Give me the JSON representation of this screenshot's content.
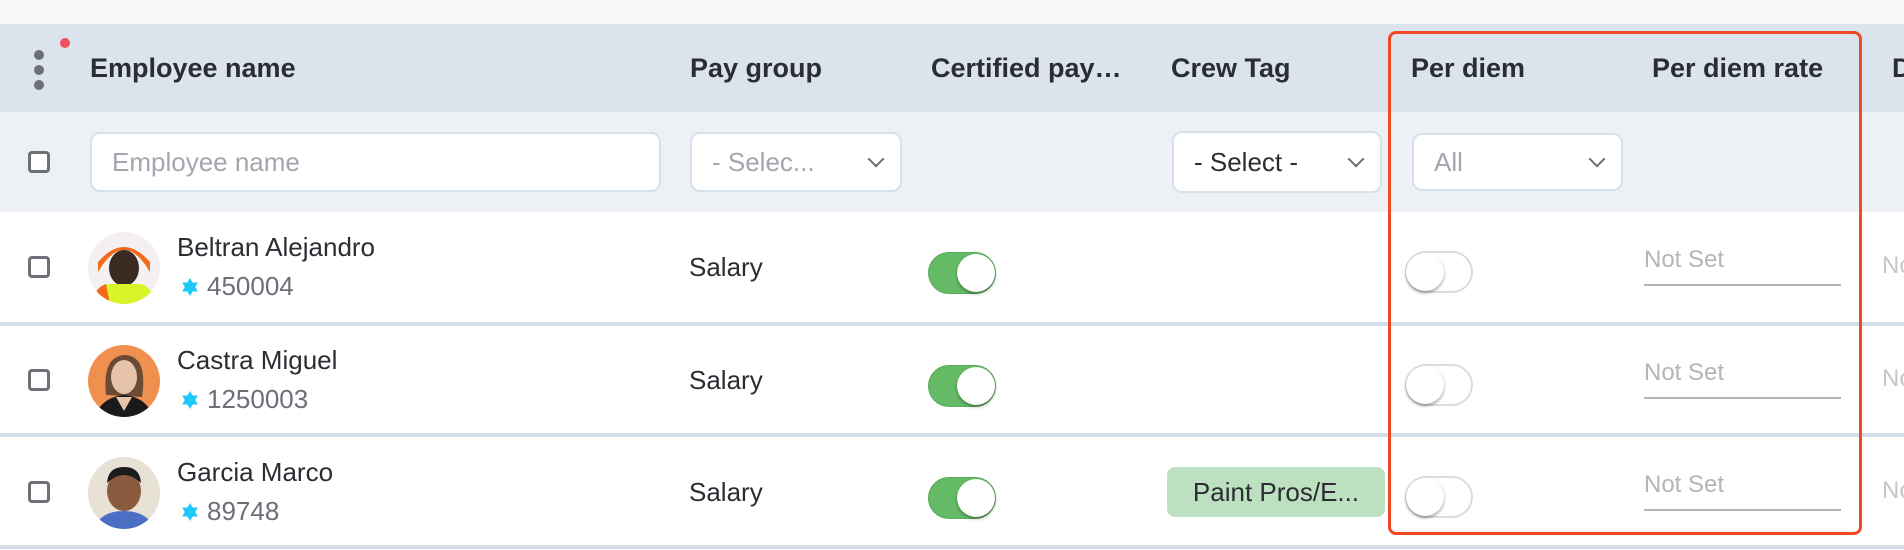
{
  "header": {
    "columns": [
      {
        "key": "employee_name",
        "label": "Employee name"
      },
      {
        "key": "pay_group",
        "label": "Pay group"
      },
      {
        "key": "certified_payroll",
        "label": "Certified pay…"
      },
      {
        "key": "crew_tag",
        "label": "Crew Tag"
      },
      {
        "key": "per_diem",
        "label": "Per diem"
      },
      {
        "key": "per_diem_rate",
        "label": "Per diem rate"
      },
      {
        "key": "next_column",
        "label": "D"
      }
    ],
    "menu_icon": "kebab-vertical-icon",
    "notification_dot_color": "#f0505c"
  },
  "filters": {
    "employee_name": {
      "value": "",
      "placeholder": "Employee name"
    },
    "pay_group": {
      "selected": "- Selec..."
    },
    "crew_tag": {
      "selected": "- Select -"
    },
    "per_diem": {
      "selected": "All"
    }
  },
  "rows": [
    {
      "name": "Beltran Alejandro",
      "employee_id": "450004",
      "pay_group": "Salary",
      "certified_payroll": true,
      "crew_tag": "",
      "per_diem": false,
      "per_diem_rate_placeholder": "Not Set",
      "next_column_value": "No"
    },
    {
      "name": "Castra Miguel",
      "employee_id": "1250003",
      "pay_group": "Salary",
      "certified_payroll": true,
      "crew_tag": "",
      "per_diem": false,
      "per_diem_rate_placeholder": "Not Set",
      "next_column_value": "No"
    },
    {
      "name": "Garcia Marco",
      "employee_id": "89748",
      "pay_group": "Salary",
      "certified_payroll": true,
      "crew_tag": "Paint Pros/E...",
      "per_diem": false,
      "per_diem_rate_placeholder": "Not Set",
      "next_column_value": "No"
    }
  ],
  "colors": {
    "toggle_on": "#65bb65",
    "chip_bg": "#bde0c0",
    "id_badge": "#1ec8f8",
    "highlight": "#f04a24",
    "header_bg": "#dbe4ed",
    "filter_bg": "#edf1f6"
  }
}
